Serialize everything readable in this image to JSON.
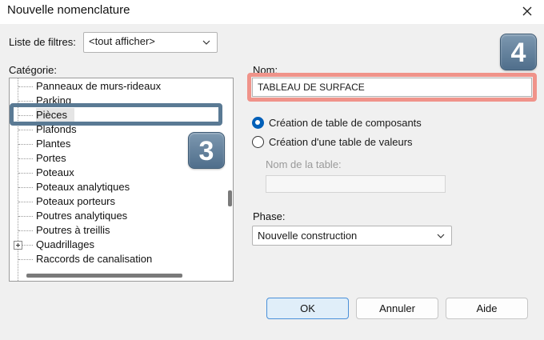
{
  "window": {
    "title": "Nouvelle nomenclature",
    "close_icon": "close-icon"
  },
  "filters": {
    "label": "Liste de filtres:",
    "value": "<tout afficher>"
  },
  "category": {
    "label": "Catégorie:",
    "items": [
      {
        "label": "Panneaux de murs-rideaux",
        "expandable": false
      },
      {
        "label": "Parking",
        "expandable": false
      },
      {
        "label": "Pièces",
        "expandable": false,
        "selected": true
      },
      {
        "label": "Plafonds",
        "expandable": false
      },
      {
        "label": "Plantes",
        "expandable": false
      },
      {
        "label": "Portes",
        "expandable": false
      },
      {
        "label": "Poteaux",
        "expandable": false
      },
      {
        "label": "Poteaux analytiques",
        "expandable": false
      },
      {
        "label": "Poteaux porteurs",
        "expandable": false
      },
      {
        "label": "Poutres analytiques",
        "expandable": false
      },
      {
        "label": "Poutres à treillis",
        "expandable": false
      },
      {
        "label": "Quadrillages",
        "expandable": true
      },
      {
        "label": "Raccords de canalisation",
        "expandable": false
      }
    ]
  },
  "name": {
    "label": "Nom:",
    "value": "TABLEAU DE SURFACE"
  },
  "schedule_type": {
    "options": [
      {
        "label": "Création de table de composants",
        "checked": true
      },
      {
        "label": "Création d'une table de valeurs",
        "checked": false
      }
    ],
    "table_name_label": "Nom de la table:",
    "table_name_value": ""
  },
  "phase": {
    "label": "Phase:",
    "value": "Nouvelle construction"
  },
  "buttons": {
    "ok": "OK",
    "cancel": "Annuler",
    "help": "Aide"
  },
  "annotations": {
    "badge_3": "3",
    "badge_4": "4",
    "callout_3_color": "#5a7a94",
    "callout_4_color": "#f0938a"
  }
}
